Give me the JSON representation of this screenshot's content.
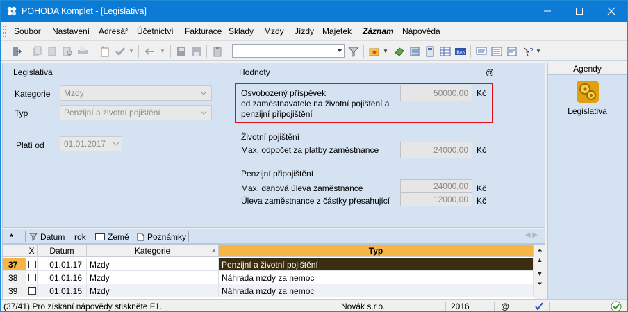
{
  "window": {
    "title": "POHODA Komplet - [Legislativa]",
    "minimize_label": "–",
    "maximize_label": "☐",
    "close_label": "✕"
  },
  "menu": [
    {
      "label": "Soubor"
    },
    {
      "label": "Nastavení"
    },
    {
      "label": "Adresář"
    },
    {
      "label": "Účetnictví"
    },
    {
      "label": "Fakturace"
    },
    {
      "label": "Sklady"
    },
    {
      "label": "Mzdy"
    },
    {
      "label": "Jízdy"
    },
    {
      "label": "Majetek"
    },
    {
      "label": "Záznam"
    },
    {
      "label": "Nápověda"
    }
  ],
  "toolbar": {
    "combo_value": ""
  },
  "form": {
    "left_heading": "Legislativa",
    "right_heading": "Hodnoty",
    "right_heading_symbol": "@",
    "kategorie_label": "Kategorie",
    "kategorie_value": "Mzdy",
    "typ_label": "Typ",
    "typ_value": "Penzijní a životní pojištění",
    "plati_od_label": "Platí od",
    "plati_od_value": "01.01.2017",
    "osvobozeny_line1": "Osvobozený příspěvek",
    "osvobozeny_line2": "od zaměstnavatele na životní pojištění a",
    "osvobozeny_line3": "penzijní připojištění",
    "osvobozeny_value": "50000,00",
    "currency": "Kč",
    "zivotni_heading": "Životní pojištění",
    "zivotni_max_label": "Max. odpočet za platby zaměstnance",
    "zivotni_max_value": "24000,00",
    "penzijni_heading": "Penzijní připojištění",
    "penzijni_max_label": "Max. daňová úleva zaměstnance",
    "penzijni_max_value": "24000,00",
    "penzijni_uleva_label": "Úleva zaměstnance z částky přesahující",
    "penzijni_uleva_value": "12000,00"
  },
  "agendy": {
    "header": "Agendy",
    "item_label": "Legislativa"
  },
  "tabs": [
    {
      "label": "*"
    },
    {
      "label": "Datum = rok"
    },
    {
      "label": "Země"
    },
    {
      "label": "Poznámky"
    }
  ],
  "grid": {
    "columns": [
      "",
      "X",
      "Datum",
      "Kategorie",
      "Typ"
    ],
    "rows": [
      {
        "num": "37",
        "datum": "01.01.17",
        "kategorie": "Mzdy",
        "typ": "Penzijní a životní pojištění",
        "selected": true
      },
      {
        "num": "38",
        "datum": "01.01.16",
        "kategorie": "Mzdy",
        "typ": "Náhrada mzdy za nemoc",
        "selected": false
      },
      {
        "num": "39",
        "datum": "01.01.15",
        "kategorie": "Mzdy",
        "typ": "Náhrada mzdy za nemoc",
        "selected": false
      }
    ]
  },
  "status": {
    "help": "(37/41) Pro získání nápovědy stiskněte F1.",
    "company": "Novák s.r.o.",
    "year": "2016",
    "at": "@"
  }
}
